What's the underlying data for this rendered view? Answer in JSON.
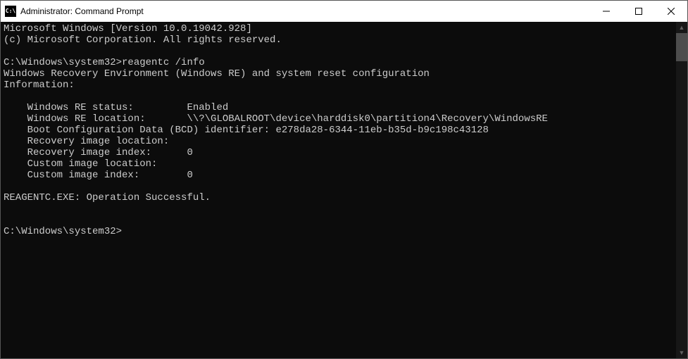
{
  "window": {
    "title": "Administrator: Command Prompt",
    "icon_label": "C:\\"
  },
  "terminal": {
    "line1": "Microsoft Windows [Version 10.0.19042.928]",
    "line2": "(c) Microsoft Corporation. All rights reserved.",
    "blank1": "",
    "prompt1": "C:\\Windows\\system32>reagentc /info",
    "line3": "Windows Recovery Environment (Windows RE) and system reset configuration",
    "line4": "Information:",
    "blank2": "",
    "line5": "    Windows RE status:         Enabled",
    "line6": "    Windows RE location:       \\\\?\\GLOBALROOT\\device\\harddisk0\\partition4\\Recovery\\WindowsRE",
    "line7": "    Boot Configuration Data (BCD) identifier: e278da28-6344-11eb-b35d-b9c198c43128",
    "line8": "    Recovery image location:",
    "line9": "    Recovery image index:      0",
    "line10": "    Custom image location:",
    "line11": "    Custom image index:        0",
    "blank3": "",
    "line12": "REAGENTC.EXE: Operation Successful.",
    "blank4": "",
    "blank5": "",
    "prompt2": "C:\\Windows\\system32>"
  }
}
